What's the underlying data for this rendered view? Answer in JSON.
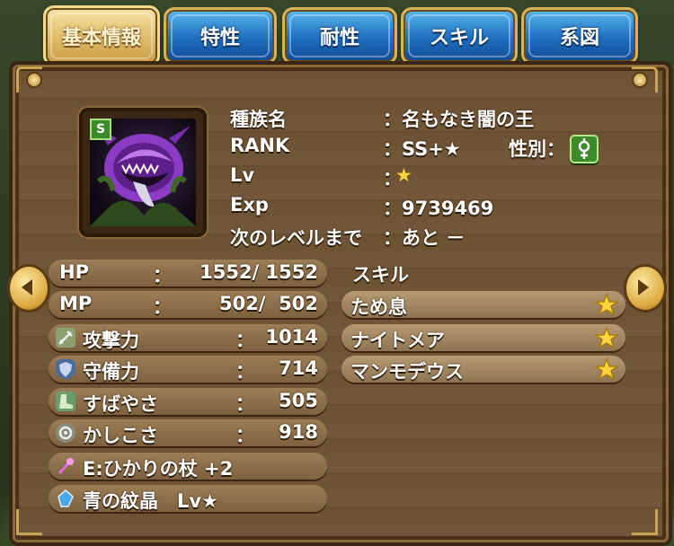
{
  "tabs": [
    "基本情報",
    "特性",
    "耐性",
    "スキル",
    "系図"
  ],
  "profile": {
    "rank_badge": "S",
    "rows": [
      {
        "label": "種族名",
        "value": "：名もなき闇の王"
      },
      {
        "label": "RANK",
        "value": "：SS+★"
      },
      {
        "label": "Lv",
        "value": "："
      },
      {
        "label": "Exp",
        "value": "：9739469"
      },
      {
        "label": "次のレベルまで",
        "value": "：あと －"
      }
    ],
    "lv_star": "★",
    "gender_label": "性別：",
    "gender_icon": "gender-neutral-icon"
  },
  "stats": {
    "hp": {
      "label": "HP",
      "sep": "：",
      "value": "1552/ 1552"
    },
    "mp": {
      "label": "MP",
      "sep": "：",
      "value": "502/  502"
    },
    "attack": {
      "label": "攻撃力",
      "sep": "：",
      "value": "1014"
    },
    "defense": {
      "label": "守備力",
      "sep": "：",
      "value": "714"
    },
    "speed": {
      "label": "すばやさ",
      "sep": "：",
      "value": "505"
    },
    "wisdom": {
      "label": "かしこさ",
      "sep": "：",
      "value": "918"
    }
  },
  "equipment": {
    "weapon": "E:ひかりの杖 +2",
    "crystal": "青の紋晶　Lv★"
  },
  "skills": {
    "header": "スキル",
    "items": [
      "ため息",
      "ナイトメア",
      "マンモデウス"
    ]
  },
  "colors": {
    "tab_blue": "#1f6fc0",
    "tab_active": "#e2bf6c",
    "star": "#ffd43a",
    "gender_badge": "#3d8a2a"
  }
}
